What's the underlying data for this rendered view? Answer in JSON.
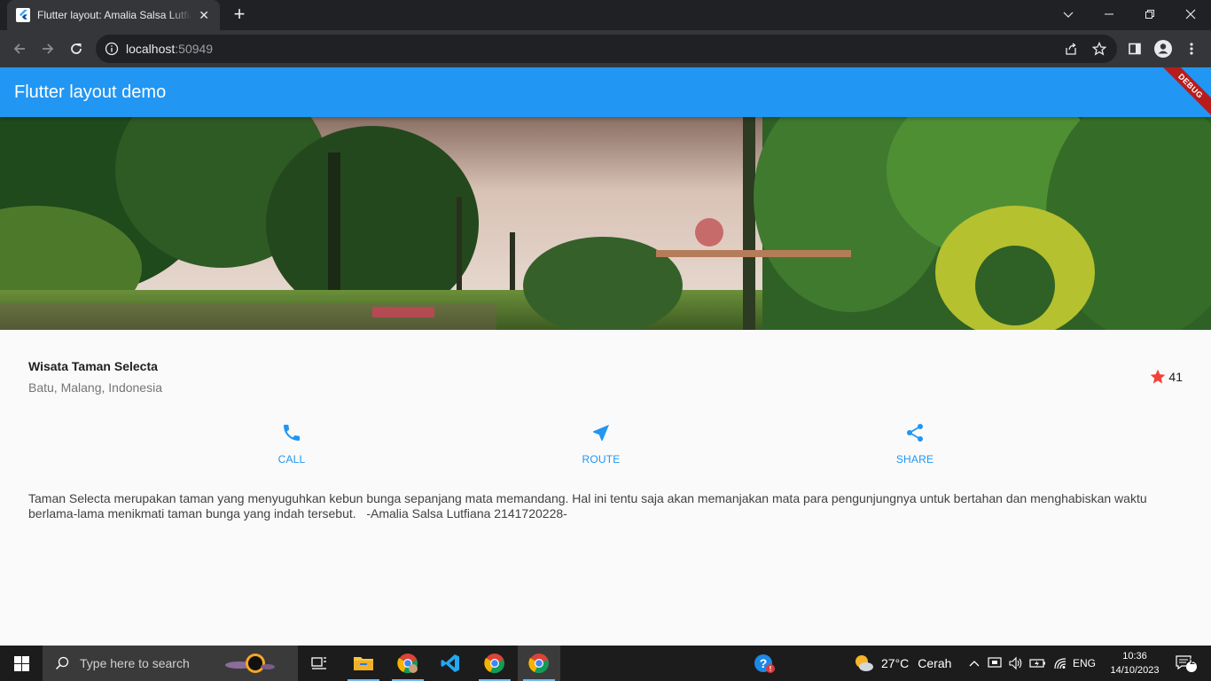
{
  "browser": {
    "tab_title": "Flutter layout: Amalia Salsa Lutfiana",
    "url_host": "localhost",
    "url_port": ":50949"
  },
  "app": {
    "appbar_title": "Flutter layout demo",
    "debug_banner": "DEBUG",
    "place_name": "Wisata Taman Selecta",
    "place_location": "Batu, Malang, Indonesia",
    "rating": "41",
    "buttons": [
      {
        "label": "CALL",
        "icon": "phone-icon"
      },
      {
        "label": "ROUTE",
        "icon": "navigation-icon"
      },
      {
        "label": "SHARE",
        "icon": "share-icon"
      }
    ],
    "description": "Taman Selecta merupakan taman yang menyuguhkan kebun bunga sepanjang mata memandang. Hal ini tentu saja akan memanjakan mata para pengunjungnya untuk bertahan dan menghabiskan waktu berlama-lama menikmati taman bunga yang indah tersebut.   -Amalia Salsa Lutfiana 2141720228-",
    "accent_color": "#2196f3",
    "star_color": "#f44336"
  },
  "taskbar": {
    "search_placeholder": "Type here to search",
    "weather_temp": "27°C",
    "weather_desc": "Cerah",
    "language": "ENG",
    "time": "10:36",
    "date": "14/10/2023",
    "notification_count": "2"
  }
}
